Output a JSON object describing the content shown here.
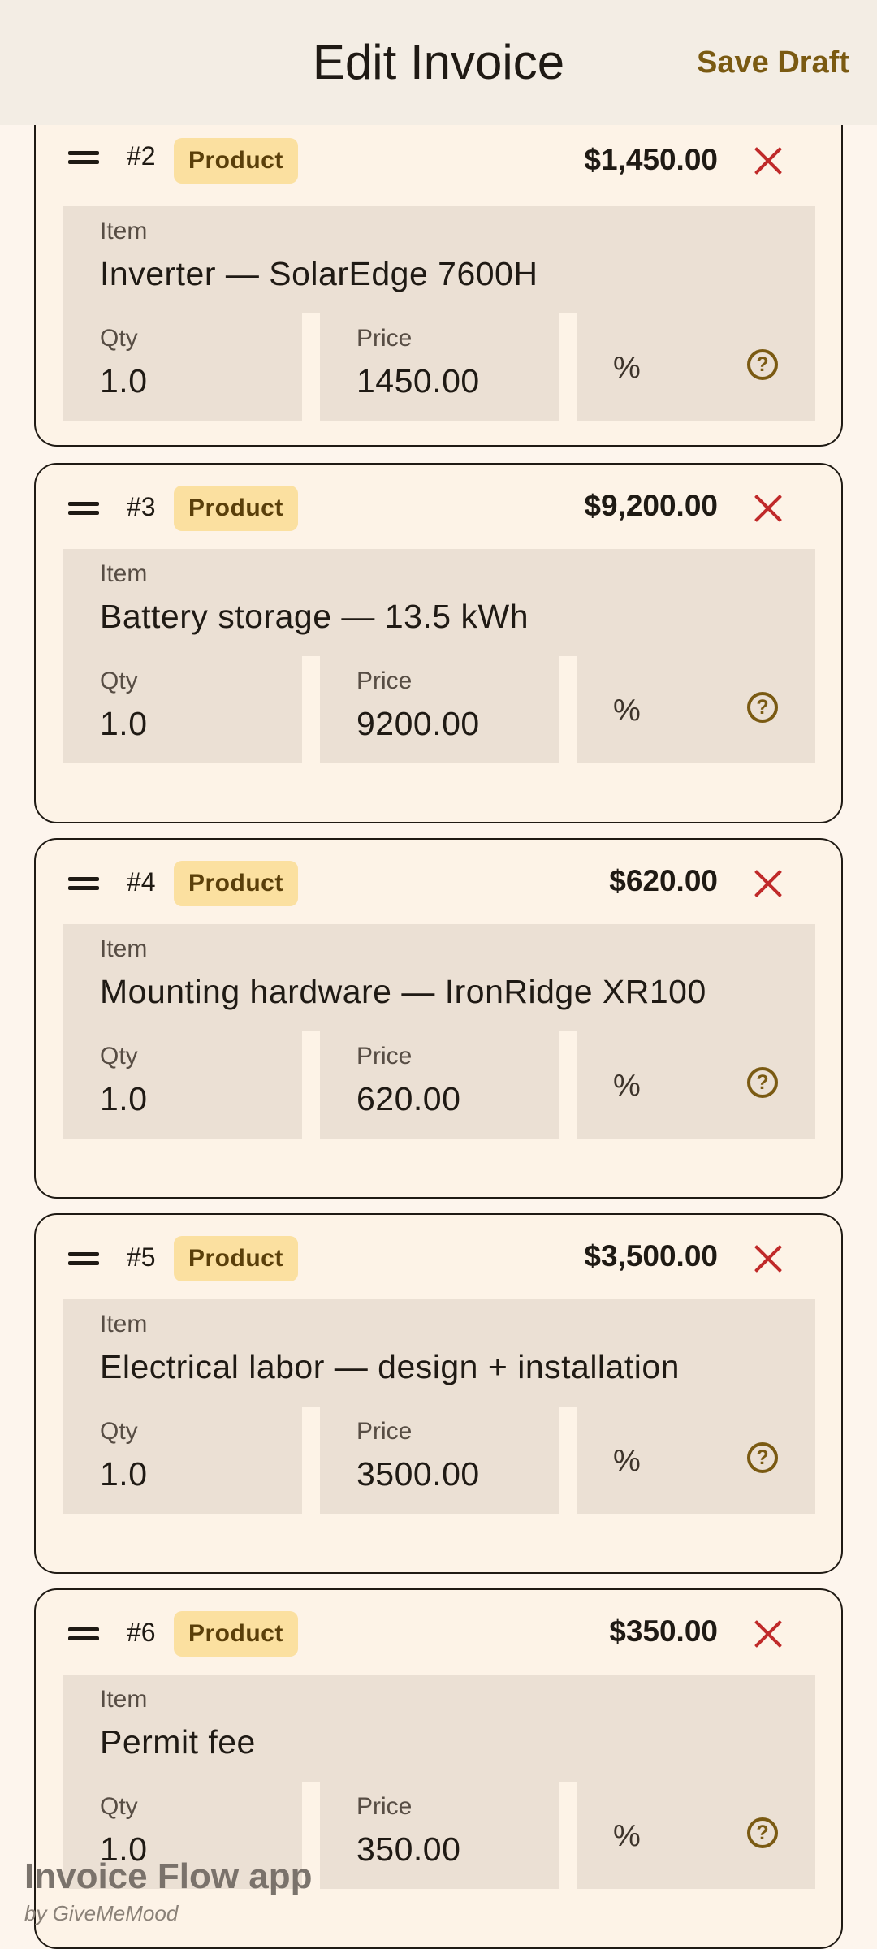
{
  "appbar": {
    "title": "Edit Invoice",
    "save_draft_label": "Save Draft"
  },
  "labels": {
    "item": "Item",
    "qty": "Qty",
    "price": "Price",
    "percent": "%",
    "help": "?"
  },
  "line_items": [
    {
      "number": "#2",
      "type": "Product",
      "total": "$1,450.00",
      "item": "Inverter — SolarEdge 7600H",
      "qty": "1.0",
      "price": "1450.00"
    },
    {
      "number": "#3",
      "type": "Product",
      "total": "$9,200.00",
      "item": "Battery storage — 13.5 kWh",
      "qty": "1.0",
      "price": "9200.00"
    },
    {
      "number": "#4",
      "type": "Product",
      "total": "$620.00",
      "item": "Mounting hardware — IronRidge XR100",
      "qty": "1.0",
      "price": "620.00"
    },
    {
      "number": "#5",
      "type": "Product",
      "total": "$3,500.00",
      "item": "Electrical labor — design + installation",
      "qty": "1.0",
      "price": "3500.00"
    },
    {
      "number": "#6",
      "type": "Product",
      "total": "$350.00",
      "item": "Permit fee",
      "qty": "1.0",
      "price": "350.00"
    }
  ],
  "watermark": {
    "title": "Invoice Flow app",
    "subtitle": "by GiveMeMood"
  },
  "colors": {
    "accent": "#7a5a12",
    "danger": "#c02a2a",
    "badge_bg": "#fbe0a0",
    "field_bg": "#ebe0d4",
    "card_bg": "#fdf3e7"
  },
  "icons": [
    "drag-handle-icon",
    "close-icon",
    "help-circle-icon"
  ]
}
